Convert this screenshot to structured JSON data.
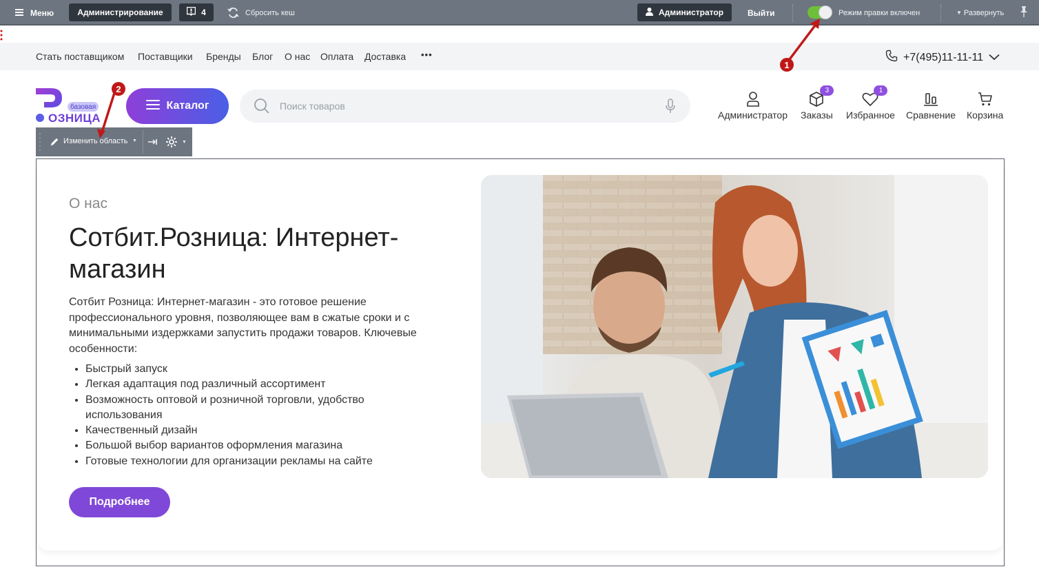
{
  "admin_bar": {
    "menu_label": "Меню",
    "admin_label": "Администрирование",
    "notifications_count": "4",
    "cache_label": "Сбросить кеш",
    "user_label": "Администратор",
    "logout_label": "Выйти",
    "edit_mode_label": "Режим правки включен",
    "expand_label": "Развернуть"
  },
  "top_nav": {
    "links": [
      "Стать поставщиком",
      "Поставщики",
      "Бренды",
      "Блог",
      "О нас",
      "Оплата",
      "Доставка"
    ],
    "more_label": "•••",
    "phone": "+7(495)11-11-11"
  },
  "header": {
    "logo_badge": "базовая",
    "logo_text": "ОЗНИЦА",
    "catalog_label": "Каталог",
    "search_placeholder": "Поиск товаров",
    "items": [
      {
        "label": "Администратор",
        "icon": "user-icon",
        "badge": ""
      },
      {
        "label": "Заказы",
        "icon": "box-icon",
        "badge": "3"
      },
      {
        "label": "Избранное",
        "icon": "heart-icon",
        "badge": "1"
      },
      {
        "label": "Сравнение",
        "icon": "compare-icon",
        "badge": ""
      },
      {
        "label": "Корзина",
        "icon": "cart-icon",
        "badge": ""
      }
    ]
  },
  "edit_toolbar": {
    "change_area_label": "Изменить область"
  },
  "about": {
    "subtitle": "О нас",
    "title": "Сотбит.Розница: Интернет-магазин",
    "description": "Сотбит Розница: Интернет-магазин - это готовое решение профессионального уровня, позволяющее вам в сжатые сроки и с минимальными издержками запустить продажи товаров. Ключевые особенности:",
    "features": [
      "Быстрый запуск",
      "Легкая адаптация под различный ассортимент",
      "Возможность оптовой и розничной торговли, удобство использования",
      "Качественный дизайн",
      "Большой выбор вариантов оформления магазина",
      "Готовые технологии для организации рекламы на сайте"
    ],
    "more_label": "Подробнее"
  },
  "annotations": {
    "marker_1": "1",
    "marker_2": "2"
  },
  "colors": {
    "admin_bar": "#6d7580",
    "accent_purple": "#8048d8",
    "toggle_on": "#6fbf3a",
    "arrow_red": "#c01818"
  }
}
